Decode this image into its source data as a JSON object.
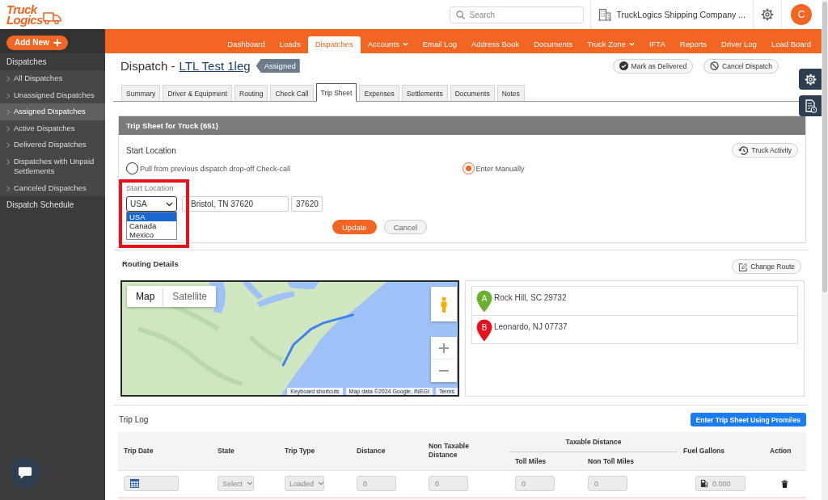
{
  "logo": {
    "line_1": "Truck",
    "line_2": "Logics"
  },
  "header": {
    "search": {
      "placeholder": "Search"
    },
    "company": "TruckLogics Shipping Company ...",
    "avatar": "C"
  },
  "sidebar": {
    "add_new": "Add New",
    "sections": [
      {
        "title": "Dispatches",
        "items": [
          {
            "label": "All Dispatches",
            "selected": false
          },
          {
            "label": "Unassigned Dispatches",
            "selected": false
          },
          {
            "label": "Assigned Dispatches",
            "selected": true
          },
          {
            "label": "Active Dispatches",
            "selected": false
          },
          {
            "label": "Delivered Dispatches",
            "selected": false
          },
          {
            "label": "Dispatches with Unpaid Settlements",
            "selected": false
          },
          {
            "label": "Canceled Dispatches",
            "selected": false
          }
        ]
      },
      {
        "title": "Dispatch Schedule"
      }
    ]
  },
  "nav": [
    {
      "label": "Dashboard",
      "selected": false,
      "has_menu": false
    },
    {
      "label": "Loads",
      "selected": false,
      "has_menu": false
    },
    {
      "label": "Dispatches",
      "selected": true,
      "has_menu": false
    },
    {
      "label": "Accounts",
      "selected": false,
      "has_menu": true
    },
    {
      "label": "Email Log",
      "selected": false,
      "has_menu": false
    },
    {
      "label": "Address Book",
      "selected": false,
      "has_menu": false
    },
    {
      "label": "Documents",
      "selected": false,
      "has_menu": false
    },
    {
      "label": "Truck Zone",
      "selected": false,
      "has_menu": true
    },
    {
      "label": "IFTA",
      "selected": false,
      "has_menu": false
    },
    {
      "label": "Reports",
      "selected": false,
      "has_menu": false
    },
    {
      "label": "Driver Log",
      "selected": false,
      "has_menu": false
    },
    {
      "label": "Load Board",
      "selected": false,
      "has_menu": false
    }
  ],
  "page": {
    "title": "Dispatch -",
    "link": "LTL Test 1leg",
    "status": "Assigned",
    "actions": [
      {
        "label": "Mark as Delivered",
        "kind": "deliver"
      },
      {
        "label": "Cancel Dispatch",
        "kind": "cancel"
      }
    ]
  },
  "tabs": [
    {
      "label": "Summary",
      "selected": false
    },
    {
      "label": "Driver & Equipment",
      "selected": false
    },
    {
      "label": "Routing",
      "selected": false
    },
    {
      "label": "Check Call",
      "selected": false
    },
    {
      "label": "Trip Sheet",
      "selected": true
    },
    {
      "label": "Expenses",
      "selected": false
    },
    {
      "label": "Settlements",
      "selected": false
    },
    {
      "label": "Documents",
      "selected": false
    },
    {
      "label": "Notes",
      "selected": false
    }
  ],
  "trip_sheet": {
    "title": "Trip Sheet for Truck (651)",
    "section_label": "Start Location",
    "truck_activity": "Truck Activity",
    "sources": [
      {
        "label": "Pull from previous dispatch drop-off Check-call",
        "selected": false
      },
      {
        "label": "Enter Manually",
        "selected": true
      }
    ],
    "field_label": "Start Location",
    "highlighted": true,
    "country": {
      "value": "USA",
      "expanded": true,
      "options": [
        {
          "label": "USA",
          "selected": true
        },
        {
          "label": "Canada",
          "selected": false
        },
        {
          "label": "Mexico",
          "selected": false
        }
      ]
    },
    "address": "Bristol, TN 37620",
    "zip": "37620",
    "buttons": [
      {
        "label": "Update",
        "kind": "primary"
      },
      {
        "label": "Cancel",
        "kind": "secondary"
      }
    ]
  },
  "routing": {
    "title": "Routing Details",
    "change_route": "Change Route",
    "map": {
      "types": [
        {
          "label": "Map",
          "selected": true
        },
        {
          "label": "Satellite",
          "selected": false
        }
      ],
      "attribution": [
        "Keyboard shortcuts",
        "Map data ©2024 Google, INEGI",
        "Terms"
      ]
    },
    "stops": [
      {
        "marker": "A",
        "address": "Rock Hill, SC 29732",
        "color": "#6ab130"
      },
      {
        "marker": "B",
        "address": "Leonardo, NJ 07737",
        "color": "#e8101b"
      }
    ]
  },
  "trip_log": {
    "title": "Trip Log",
    "promiles_button": "Enter Trip Sheet Using Promiles",
    "columns": [
      {
        "label": "Trip Date"
      },
      {
        "label": "State"
      },
      {
        "label": "Trip Type"
      },
      {
        "label": "Distance"
      },
      {
        "label": "Non Taxable Distance"
      },
      {
        "label": "Taxable Distance",
        "children": [
          {
            "label": "Toll Miles"
          },
          {
            "label": "Non Toll Miles"
          }
        ]
      },
      {
        "label": "Fuel Gallons"
      },
      {
        "label": "Action"
      }
    ],
    "rows": [
      {
        "flagged": false,
        "state": "Select",
        "trip_type": "Loaded",
        "distance": "0",
        "non_taxable_distance": "0",
        "toll_miles": "0",
        "non_toll_miles": "0",
        "fuel_gallons": "0.000"
      },
      {
        "flagged": true
      }
    ]
  }
}
